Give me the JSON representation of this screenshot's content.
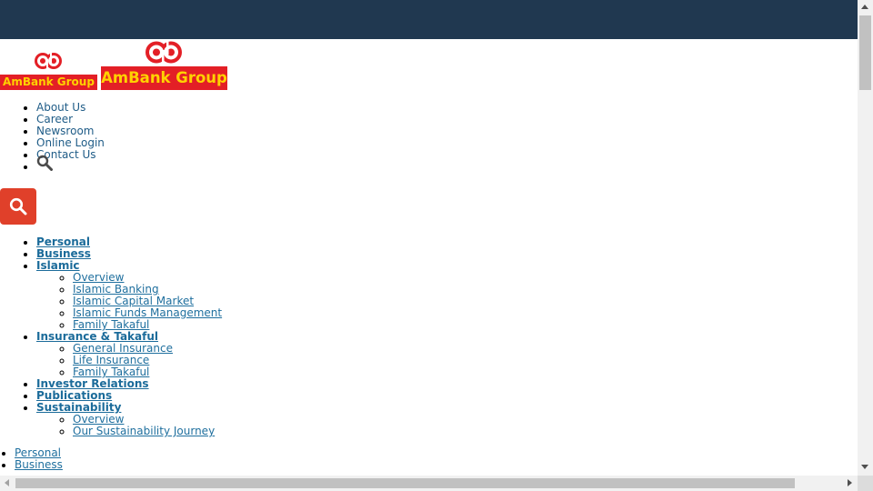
{
  "colors": {
    "topbar": "#203850",
    "brand_red": "#e31f26",
    "brand_yellow": "#ffd200",
    "search_button": "#e0402a",
    "link": "#1f5c87"
  },
  "logos": {
    "small_text": "AmBank Group",
    "big_text": "AmBank Group"
  },
  "utility_nav": {
    "items": [
      "About Us",
      "Career",
      "Newsroom",
      "Online Login",
      "Contact Us"
    ],
    "search_icon": "search-icon"
  },
  "search_button": {
    "icon": "search-icon"
  },
  "main_nav": {
    "personal": "Personal",
    "business": "Business",
    "islamic": {
      "label": "Islamic",
      "children": [
        "Overview",
        "Islamic Banking",
        "Islamic Capital Market",
        "Islamic Funds Management",
        "Family Takaful"
      ]
    },
    "insurance": {
      "label": "Insurance & Takaful",
      "children": [
        "General Insurance",
        "Life Insurance",
        "Family Takaful"
      ]
    },
    "investor": "Investor Relations",
    "publications": "Publications",
    "sustainability": {
      "label": "Sustainability",
      "children": [
        "Overview",
        "Our Sustainability Journey"
      ]
    }
  },
  "mobile_nav": {
    "items": [
      "Personal",
      "Business"
    ]
  }
}
